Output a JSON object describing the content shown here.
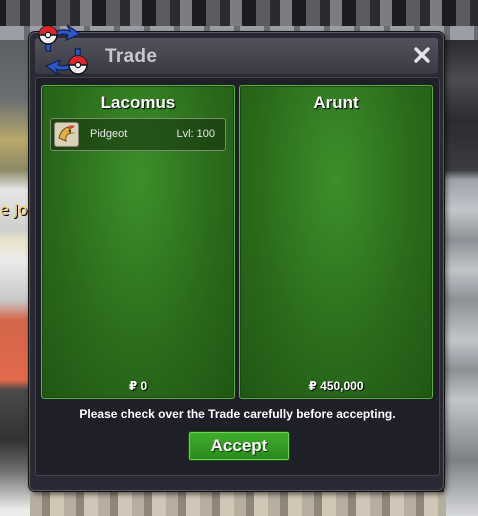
{
  "background": {
    "partial_text": "e Joy"
  },
  "window": {
    "title": "Trade",
    "close_icon": "close-icon",
    "logo_icon": "trade-logo-icon"
  },
  "left_panel": {
    "player_name": "Lacomus",
    "items": [
      {
        "name": "Pidgeot",
        "level": "Lvl: 100",
        "icon": "pidgeot-icon"
      }
    ],
    "money": "₽ 0"
  },
  "right_panel": {
    "player_name": "Arunt",
    "items": [],
    "money": "₽ 450,000"
  },
  "notice": "Please check over the Trade carefully before accepting.",
  "accept_label": "Accept",
  "colors": {
    "panel_green": "#2b6c1c",
    "accept_green": "#2a8a1c",
    "window_bg": "#2a2a36"
  }
}
